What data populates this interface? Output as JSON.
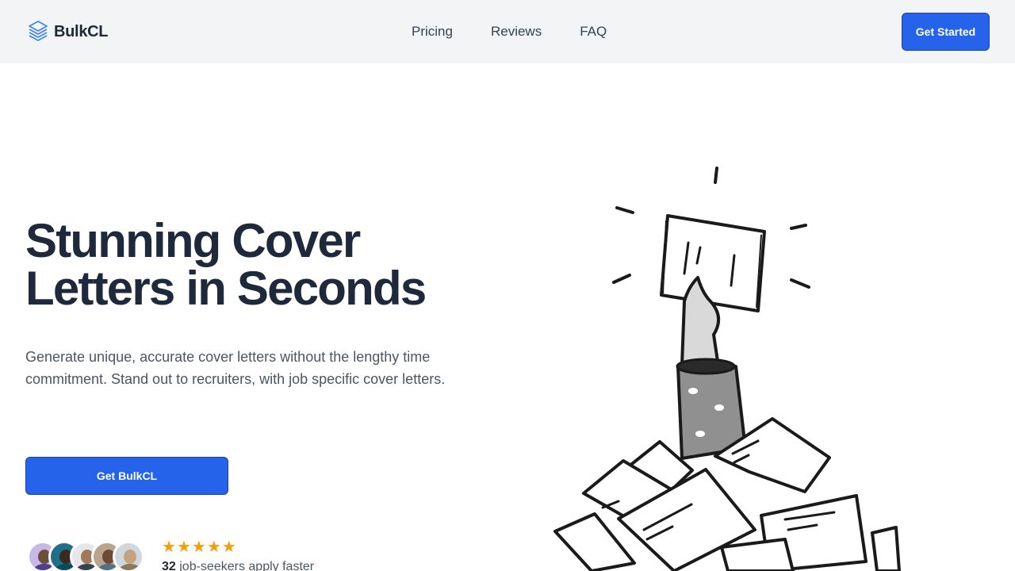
{
  "nav": {
    "brand": "BulkCL",
    "links": [
      "Pricing",
      "Reviews",
      "FAQ"
    ],
    "cta": "Get Started"
  },
  "hero": {
    "title_line1": "Stunning Cover",
    "title_line2": "Letters in Seconds",
    "subtitle": "Generate unique, accurate cover letters without the lengthy time commitment. Stand out to recruiters, with job specific cover letters.",
    "cta": "Get BulkCL"
  },
  "social_proof": {
    "stars": 5,
    "count": "32",
    "text": "job-seekers apply faster"
  },
  "colors": {
    "accent": "#2563eb",
    "accent_border": "#1e40af",
    "nav_bg": "#f3f4f6",
    "heading": "#1e293b",
    "star": "#f59e0b"
  },
  "icons": {
    "logo": "stacked-layers-icon",
    "star": "star-icon"
  }
}
